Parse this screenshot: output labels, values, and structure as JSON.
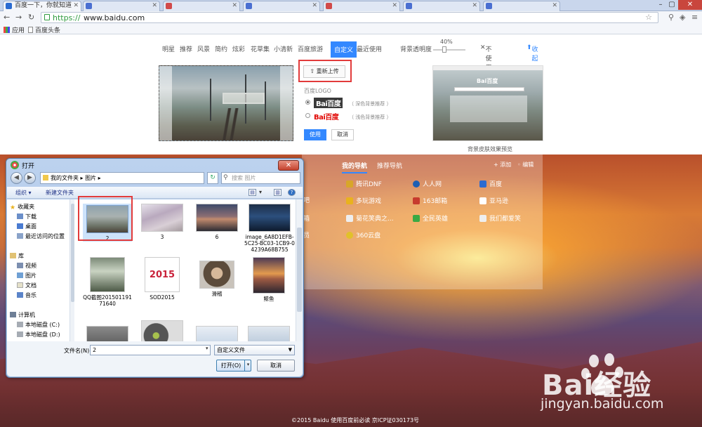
{
  "browser": {
    "tabs": [
      {
        "label": "百度一下，你就知道",
        "active": true
      },
      {
        "label": "",
        "active": false
      },
      {
        "label": "",
        "active": false
      },
      {
        "label": "",
        "active": false
      },
      {
        "label": "",
        "active": false
      },
      {
        "label": "",
        "active": false
      }
    ],
    "url_scheme": "https://",
    "url_host": "www.baidu.com",
    "bookmarks": [
      "应用",
      "百度头条"
    ]
  },
  "skin_nav": {
    "items": [
      "明星",
      "推荐",
      "风景",
      "简约",
      "炫彩",
      "花草集",
      "小清新",
      "百度旅游",
      "自定义",
      "最近使用"
    ],
    "selected": "自定义",
    "opacity_label": "背景透明度",
    "opacity_value": "40%",
    "no_skin": "不使用换肤",
    "collapse": "收起"
  },
  "custom": {
    "reupload": "重新上传",
    "logo_label": "百度LOGO",
    "logo_white_text": "Bai百度",
    "logo_color_text": "Bai百度",
    "hint_dark": "（ 深色背景推荐 ）",
    "hint_light": "（ 浅色背景推荐 ）",
    "use_btn": "使用",
    "cancel_btn": "取消",
    "preview_caption": "背景皮肤效果预览",
    "preview_logo": "Bai百度"
  },
  "nav_panel": {
    "tabs": [
      "我的导航",
      "推荐导航"
    ],
    "add": "添加",
    "edit": "编辑",
    "sites": [
      [
        "腾讯DNF",
        "人人网",
        "百度"
      ],
      [
        "多玩游戏",
        "163邮箱",
        "亚马逊"
      ],
      [
        "菊花笑典之...",
        "全民英雄",
        "我们都爱笑"
      ],
      [
        "360云盘",
        "",
        ""
      ]
    ],
    "left_fragments": [
      "吧",
      "箱",
      "员"
    ]
  },
  "dialog": {
    "title": "打开",
    "path": "我的文件夹 ▸ 图片 ▸",
    "search_placeholder": "搜索 图片",
    "organize": "组织 ▾",
    "new_folder": "新建文件夹",
    "sidebar": [
      {
        "label": "收藏夹",
        "type": "star"
      },
      {
        "label": "下载",
        "type": "folder"
      },
      {
        "label": "桌面",
        "type": "folder"
      },
      {
        "label": "最近访问的位置",
        "type": "folder"
      },
      {
        "label": "库",
        "type": "lib"
      },
      {
        "label": "视频",
        "type": "folder"
      },
      {
        "label": "图片",
        "type": "folder"
      },
      {
        "label": "文档",
        "type": "folder"
      },
      {
        "label": "音乐",
        "type": "folder"
      },
      {
        "label": "计算机",
        "type": "pc"
      },
      {
        "label": "本地磁盘 (C:)",
        "type": "disk"
      },
      {
        "label": "本地磁盘 (D:)",
        "type": "disk"
      }
    ],
    "files": [
      {
        "name": "2",
        "selected": true
      },
      {
        "name": "3",
        "selected": false
      },
      {
        "name": "6",
        "selected": false
      },
      {
        "name": "image_6A8D1EFB-5C25-BC03-1CB9-04239A68B755",
        "selected": false
      },
      {
        "name": "QQ截图20150119171640",
        "selected": false
      },
      {
        "name": "SOD2015",
        "selected": false
      },
      {
        "name": "滑稽",
        "selected": false
      },
      {
        "name": "鲸鱼",
        "selected": false
      },
      {
        "name": "",
        "selected": false
      },
      {
        "name": "",
        "selected": false
      },
      {
        "name": "",
        "selected": false
      },
      {
        "name": "",
        "selected": false
      }
    ],
    "filename_label": "文件名(N):",
    "filename_value": "2",
    "filetype": "自定义文件",
    "open_btn": "打开(O)",
    "cancel_btn": "取消"
  },
  "footer": "©2015  Baidu  使用百度前必读  京ICP证030173号",
  "watermark": {
    "text": "Bai经验",
    "url": "jingyan.baidu.com"
  }
}
